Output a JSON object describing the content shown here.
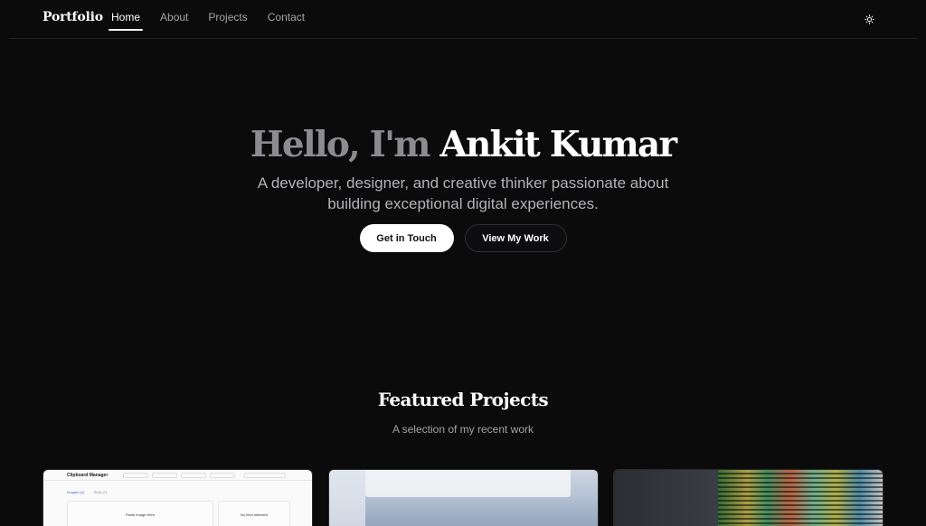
{
  "nav": {
    "brand": "Portfolio",
    "links": [
      "Home",
      "About",
      "Projects",
      "Contact"
    ],
    "active": "Home",
    "theme_icon": "sun-icon"
  },
  "hero": {
    "greeting": "Hello, I'm",
    "name": "Ankit Kumar",
    "subtitle": "A developer, designer, and creative thinker passionate about building exceptional digital experiences.",
    "primary_button": "Get in Touch",
    "secondary_button": "View My Work"
  },
  "featured": {
    "title": "Featured Projects",
    "subtitle": "A selection of my recent work"
  },
  "cards": {
    "card1": {
      "app_title": "Clipboard Manager",
      "tab_label": "Images (4)",
      "tab_label_2": "Texts (7)",
      "panel1_title": "Paste Image Here",
      "panel2_title": "No item selected"
    }
  }
}
